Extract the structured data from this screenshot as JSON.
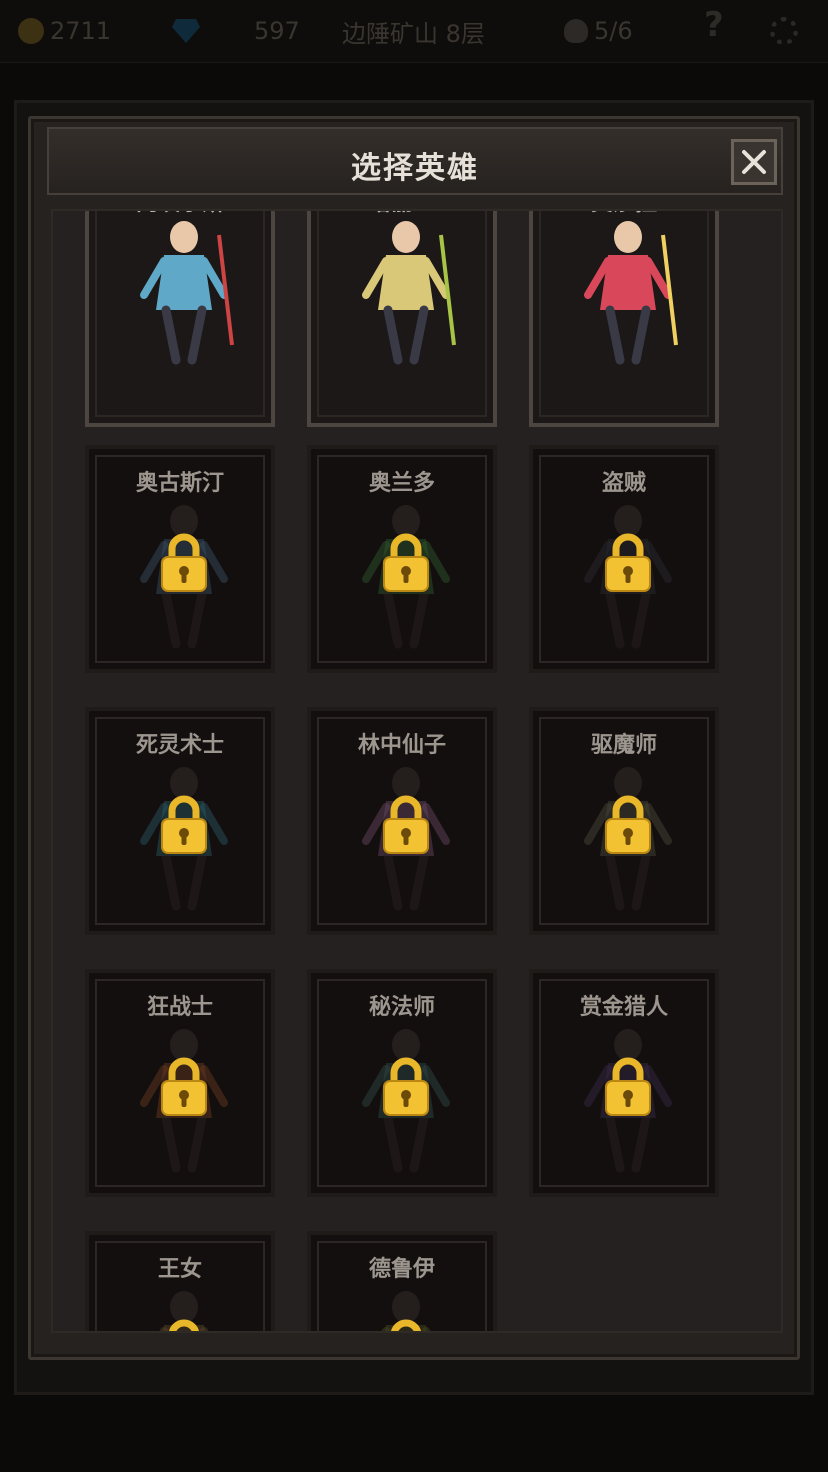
{
  "topbar": {
    "gold": "2711",
    "gems": "597",
    "location": "边陲矿山 8层",
    "skulls": "5/6",
    "help": "?"
  },
  "dialog": {
    "title": "选择英雄",
    "close": "✕"
  },
  "heroes": [
    {
      "name": "冈埃尔斯",
      "locked": false,
      "color": "#5fa8c8",
      "accent": "#c44"
    },
    {
      "name": "塔丽亚",
      "locked": false,
      "color": "#d8c878",
      "accent": "#a7c447"
    },
    {
      "name": "艾莎拉",
      "locked": false,
      "color": "#d8485a",
      "accent": "#f0d060"
    },
    {
      "name": "奥古斯汀",
      "locked": true,
      "color": "#3a4f66"
    },
    {
      "name": "奥兰多",
      "locked": true,
      "color": "#2f5a2f"
    },
    {
      "name": "盗贼",
      "locked": true,
      "color": "#2a2a33"
    },
    {
      "name": "死灵术士",
      "locked": true,
      "color": "#2a5a66"
    },
    {
      "name": "林中仙子",
      "locked": true,
      "color": "#6a4a66"
    },
    {
      "name": "驱魔师",
      "locked": true,
      "color": "#4a4a3a"
    },
    {
      "name": "狂战士",
      "locked": true,
      "color": "#6a3a22"
    },
    {
      "name": "秘法师",
      "locked": true,
      "color": "#2f4a48"
    },
    {
      "name": "赏金猎人",
      "locked": true,
      "color": "#3a2a4a"
    },
    {
      "name": "王女",
      "locked": true,
      "color": "#5a4a2a"
    },
    {
      "name": "德鲁伊",
      "locked": true,
      "color": "#4a4a22"
    }
  ]
}
